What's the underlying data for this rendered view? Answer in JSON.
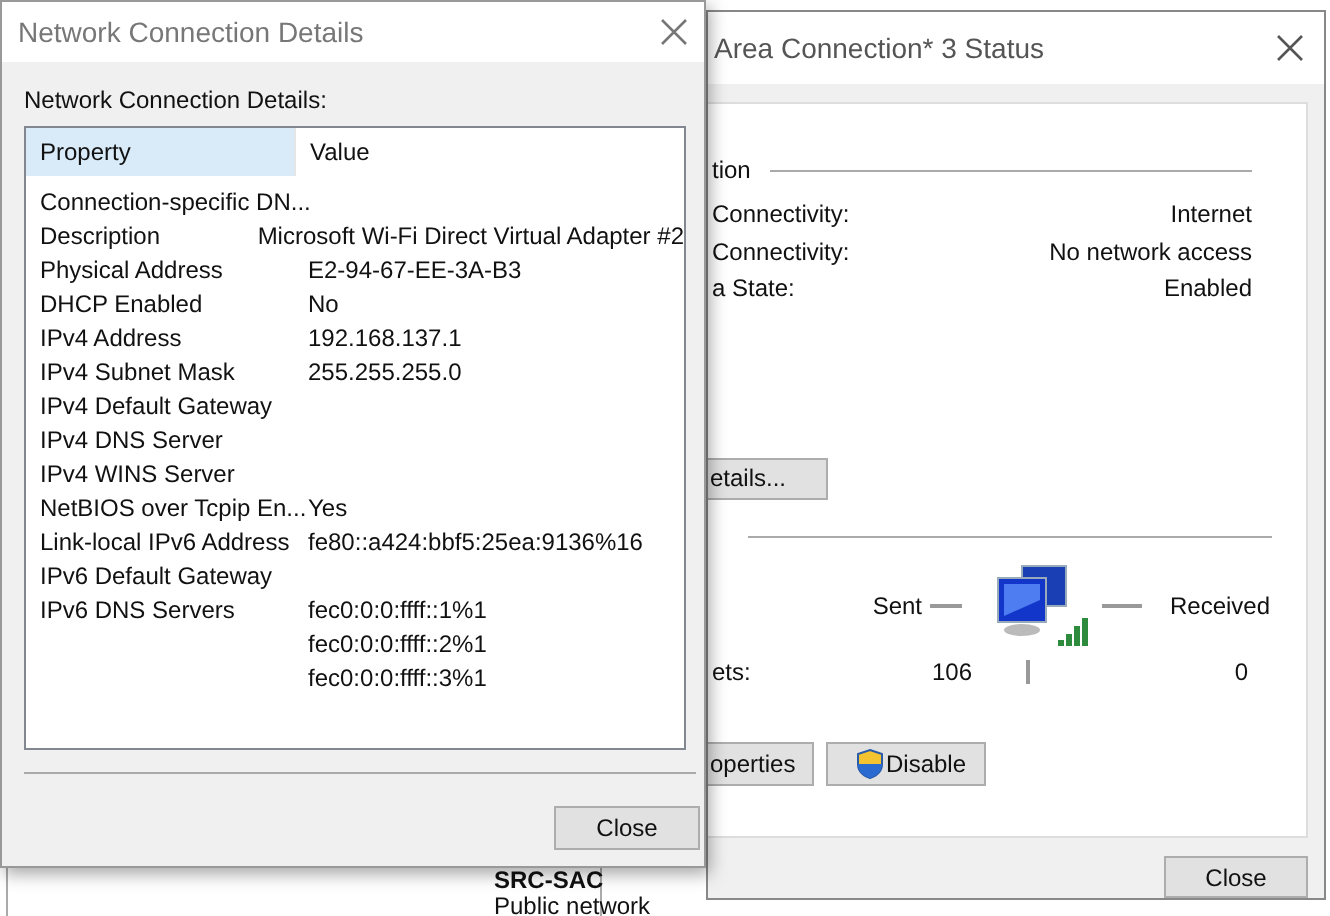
{
  "background": {
    "texts": [
      "SRC-SAC",
      "Public network"
    ]
  },
  "status_window": {
    "title": "Area Connection* 3 Status",
    "section_title": "tion",
    "rows": [
      {
        "label": "Connectivity:",
        "value": "Internet"
      },
      {
        "label": "Connectivity:",
        "value": "No network access"
      },
      {
        "label": "a State:",
        "value": "Enabled"
      }
    ],
    "details_button": "etails...",
    "activity": {
      "sent": "Sent",
      "received": "Received",
      "label": "ets:",
      "sent_value": "106",
      "received_value": "0"
    },
    "buttons": [
      {
        "label": "operties",
        "kind": "plain"
      },
      {
        "label": "Disable",
        "kind": "shield"
      }
    ],
    "close_button": "Close"
  },
  "details_window": {
    "title": "Network Connection Details",
    "label": "Network Connection Details:",
    "columns": [
      {
        "label": "Property",
        "highlighted": true
      },
      {
        "label": "Value",
        "highlighted": false
      }
    ],
    "rows": [
      {
        "property": "Connection-specific DN..."
      },
      {
        "property": "Description",
        "value": "Microsoft Wi-Fi Direct Virtual Adapter #2"
      },
      {
        "property": "Physical Address",
        "value": "E2-94-67-EE-3A-B3"
      },
      {
        "property": "DHCP Enabled",
        "value": "No"
      },
      {
        "property": "IPv4 Address",
        "value": "192.168.137.1"
      },
      {
        "property": "IPv4 Subnet Mask",
        "value": "255.255.255.0"
      },
      {
        "property": "IPv4 Default Gateway"
      },
      {
        "property": "IPv4 DNS Server"
      },
      {
        "property": "IPv4 WINS Server"
      },
      {
        "property": "NetBIOS over Tcpip En...",
        "value": "Yes"
      },
      {
        "property": "Link-local IPv6 Address",
        "value": "fe80::a424:bbf5:25ea:9136%16"
      },
      {
        "property": "IPv6 Default Gateway"
      },
      {
        "property": "IPv6 DNS Servers",
        "value": "fec0:0:0:ffff::1%1"
      },
      {
        "value": "fec0:0:0:ffff::2%1"
      },
      {
        "value": "fec0:0:0:ffff::3%1"
      }
    ],
    "close_button": "Close"
  }
}
